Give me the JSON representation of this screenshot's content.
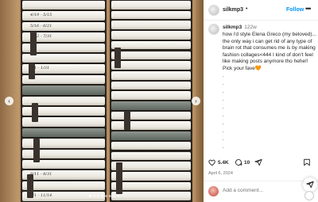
{
  "post": {
    "username": "silkmp3",
    "follow_label": "Follow",
    "more_label": "•••",
    "header_separator": "•",
    "caption_username": "silkmp3",
    "caption_time": "122w",
    "caption_text": "how i'd style Elena Greco (my beloved)... the only way i can get rid of any type of brain rot that consumes me is by making fashion collages<444 I kind of don't feel like making posts anymore tho hehe!! Pick your fave🧡",
    "caption_dots": [
      ".",
      ".",
      ".",
      ".",
      ".",
      ".",
      ".",
      ".",
      ".",
      "."
    ],
    "like_count": "5.4K",
    "comment_count": "10",
    "date": "April 6, 2024",
    "comment_placeholder": "Add a comment..."
  },
  "photo": {
    "prev_glyph": "‹",
    "next_glyph": "›",
    "slides_total": 8,
    "slide_active": 1,
    "left_labels": [
      "",
      "4/19 - 5/15",
      "5/16 - 6/21",
      "6/22 - 7/31",
      "",
      "",
      "1/1 - 1/31",
      "",
      "",
      "",
      "",
      "",
      "",
      "",
      "",
      "",
      "8/11 - 8/31",
      "",
      "9/1 - 11/14"
    ],
    "right_labels": [
      "",
      "",
      "",
      "",
      "",
      "",
      "",
      "",
      "",
      "",
      "",
      "",
      "",
      "",
      "",
      "",
      "",
      "",
      "",
      ""
    ]
  },
  "colors": {
    "accent": "#0095f6",
    "box": "#b58d61",
    "text": "#262626",
    "muted": "#737373"
  },
  "icons": {
    "like": "heart-icon",
    "comment": "comment-bubble-icon",
    "share": "send-icon",
    "save": "bookmark-icon",
    "more": "more-dots-icon",
    "prev": "chevron-left-icon",
    "next": "chevron-right-icon"
  }
}
